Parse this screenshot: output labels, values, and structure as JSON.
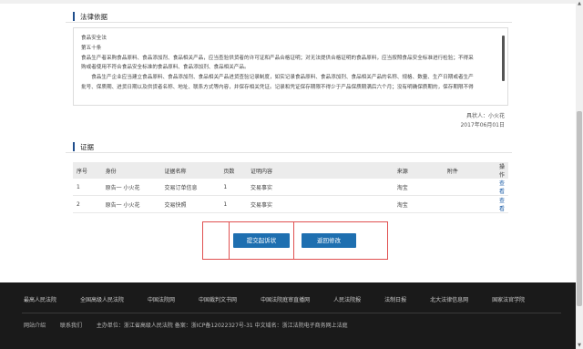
{
  "legal_basis": {
    "title": "法律依据",
    "lines": [
      "食品安全法",
      "第五十条",
      "食品生产者采购食品原料、食品添加剂、食品相关产品，应当查验供货者的许可证和产品合格证明；对无法提供合格证明的食品原料，应当按照食品安全标准进行检验；不得采",
      "购或者使用不符合食品安全标准的食品原料、食品添加剂、食品相关产品。",
      "　　食品生产企业应当建立食品原料、食品添加剂、食品相关产品进货查验记录制度，如实记录食品原料、食品添加剂、食品相关产品的名称、规格、数量、生产日期或者生产",
      "批号、保质期、进货日期以及供货者名称、地址、联系方式等内容，并保存相关凭证。记录和凭证保存期限不得少于产品保质期满后六个月；没有明确保质期的，保存期限不得"
    ],
    "signer": "具状人：小火花",
    "date": "2017年06月01日"
  },
  "evidence": {
    "title": "证据",
    "headers": [
      "序号",
      "身份",
      "证据名称",
      "页数",
      "证明内容",
      "来源",
      "附件",
      "操作"
    ],
    "rows": [
      [
        "1",
        "原告一 小火花",
        "交易订单信息",
        "1",
        "交易事实",
        "淘宝",
        "",
        "查看"
      ],
      [
        "2",
        "原告一 小火花",
        "交易快照",
        "1",
        "交易事实",
        "淘宝",
        "",
        "查看"
      ]
    ]
  },
  "actions": {
    "submit_label": "提交起诉状",
    "back_label": "返回修改"
  },
  "footer": {
    "links": [
      "最高人民法院",
      "全国高级人民法院",
      "中国法院网",
      "中国裁判文书网",
      "中国法院庭审直播网",
      "人民法院报",
      "法制日报",
      "北大法律信息网",
      "国家法官学院"
    ],
    "bottom_links": [
      "网站介绍",
      "联系我们"
    ],
    "host": "主办单位：浙江省高级人民法院 备案：浙ICP备12022327号-31 中文域名：浙江法院电子商务网上法庭"
  },
  "colors": {
    "accent": "#1e6fb0",
    "highlight_border": "#e05050",
    "footer_bg": "#1a1a1a"
  }
}
